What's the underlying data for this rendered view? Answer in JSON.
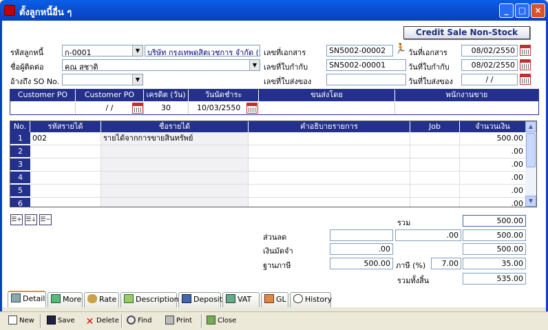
{
  "window": {
    "title": "ตั้งลูกหนี้อื่น ๆ",
    "minimize": "_",
    "maximize": "□",
    "close": "×"
  },
  "header": {
    "credit_sale_button": "Credit Sale Non-Stock",
    "customer_code_label": "รหัสลูกหนี้",
    "customer_code": "ก-0001",
    "customer_name": "บริษัท กรุงเทพดุสิตเวชการ จำกัด (ม",
    "contact_label": "ชื่อผู้ติดต่อ",
    "contact": "คุณ สุชาติ",
    "so_ref_label": "อ้างถึง SO No.",
    "so_ref": "",
    "doc_no_label": "เลขที่เอกสาร",
    "doc_no": "SN5002-00002",
    "invoice_no_label": "เลขที่ใบกำกับ",
    "invoice_no": "SN5002-00001",
    "delivery_no_label": "เลขที่ใบส่งของ",
    "delivery_no": "",
    "doc_date_label": "วันที่เอกสาร",
    "doc_date": "08/02/2550",
    "invoice_date_label": "วันที่ใบกำกับ",
    "invoice_date": "08/02/2550",
    "delivery_date_label": "วันที่ใบส่งของ",
    "delivery_date": "/ /"
  },
  "po_table": {
    "headers": [
      "Customer PO",
      "Customer PO Date",
      "เครดิต (วัน)",
      "วันนัดชำระ",
      "ขนส่งโดย",
      "พนักงานขาย"
    ],
    "values": [
      "",
      "/ /",
      "30",
      "10/03/2550",
      "",
      ""
    ]
  },
  "grid": {
    "headers": [
      "No.",
      "รหัสรายได้",
      "ชื่อรายได้",
      "คำอธิบายรายการ",
      "Job",
      "จำนวนเงิน"
    ],
    "rows": [
      {
        "no": "1",
        "code": "002",
        "name": "รายได้จากการขายสินทรัพย์",
        "desc": "",
        "job": "",
        "amount": "500.00"
      },
      {
        "no": "2",
        "code": "",
        "name": "",
        "desc": "",
        "job": "",
        "amount": ".00"
      },
      {
        "no": "3",
        "code": "",
        "name": "",
        "desc": "",
        "job": "",
        "amount": ".00"
      },
      {
        "no": "4",
        "code": "",
        "name": "",
        "desc": "",
        "job": "",
        "amount": ".00"
      },
      {
        "no": "5",
        "code": "",
        "name": "",
        "desc": "",
        "job": "",
        "amount": ".00"
      },
      {
        "no": "6",
        "code": "",
        "name": "",
        "desc": "",
        "job": "",
        "amount": ".00"
      }
    ]
  },
  "totals": {
    "sum_label": "รวม",
    "sum": "500.00",
    "discount_label": "ส่วนลด",
    "discount_input": "",
    "discount_amount": ".00",
    "discount_total": "500.00",
    "deposit_label": "เงินมัดจำ",
    "deposit": ".00",
    "deposit_total": "500.00",
    "tax_base_label": "ฐานภาษี",
    "tax_base": "500.00",
    "vat_label": "ภาษี (%)",
    "vat_rate": "7.00",
    "vat_amount": "35.00",
    "grand_total_label": "รวมทั้งสิ้น",
    "grand_total": "535.00"
  },
  "tabs": [
    "Detail",
    "More",
    "Rate",
    "Description",
    "Deposit",
    "VAT",
    "GL",
    "History"
  ],
  "toolbar": {
    "new": "New",
    "save": "Save",
    "delete": "Delete",
    "find": "Find",
    "print": "Print",
    "close": "Close"
  },
  "colors": {
    "header_blue": "#24318c",
    "title_blue": "#0a5fe8",
    "tab_accent": "#e68b2c"
  }
}
